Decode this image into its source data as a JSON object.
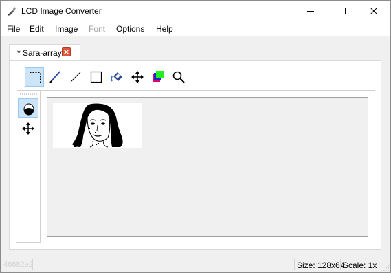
{
  "window": {
    "title": "LCD Image Converter"
  },
  "menu": {
    "items": [
      {
        "label": "File",
        "enabled": true
      },
      {
        "label": "Edit",
        "enabled": true
      },
      {
        "label": "Image",
        "enabled": true
      },
      {
        "label": "Font",
        "enabled": false
      },
      {
        "label": "Options",
        "enabled": true
      },
      {
        "label": "Help",
        "enabled": true
      }
    ]
  },
  "tabs": [
    {
      "label": "* Sara-array",
      "active": true
    }
  ],
  "toolbar": {
    "tools": [
      {
        "icon": "select-rectangle-icon",
        "active": true
      },
      {
        "icon": "pen-icon",
        "active": false
      },
      {
        "icon": "line-icon",
        "active": false
      },
      {
        "icon": "rectangle-icon",
        "active": false
      },
      {
        "icon": "fill-bucket-icon",
        "active": false
      },
      {
        "icon": "move-icon",
        "active": false
      },
      {
        "icon": "color-picker-icon",
        "active": false
      },
      {
        "icon": "zoom-icon",
        "active": false
      }
    ]
  },
  "options_bar": {
    "tools": [
      {
        "icon": "invert-select-icon",
        "active": true
      },
      {
        "icon": "move-icon",
        "active": false
      }
    ]
  },
  "canvas": {
    "image_width": 128,
    "image_height": 64,
    "scale": 1
  },
  "status": {
    "left_text": "46682e2",
    "size": "Size: 128x64",
    "scale": "Scale: 1x"
  },
  "colors": {
    "accent_active": "#cce4f7",
    "tab_close": "#e0563a"
  }
}
